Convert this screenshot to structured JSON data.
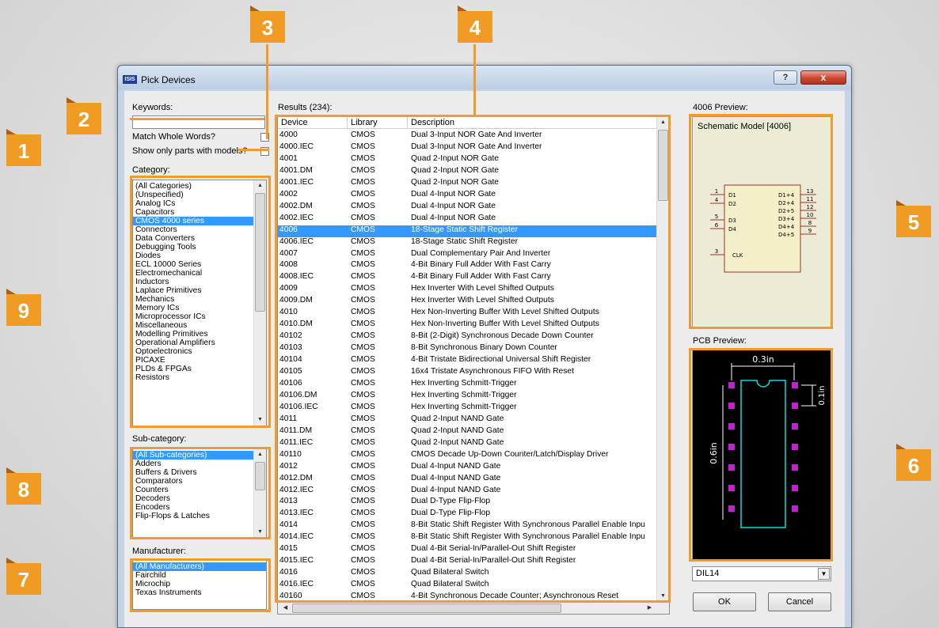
{
  "window": {
    "title": "Pick Devices",
    "app_badge": "ISIS",
    "help_label": "?",
    "close_label": "x"
  },
  "keywords": {
    "label": "Keywords:",
    "value": ""
  },
  "match_whole_words": {
    "label": "Match Whole Words?",
    "checked": false
  },
  "show_models": {
    "label": "Show only parts with models?",
    "checked": false
  },
  "category": {
    "label": "Category:",
    "items": [
      "(All Categories)",
      "(Unspecified)",
      "Analog ICs",
      "Capacitors",
      "CMOS 4000 series",
      "Connectors",
      "Data Converters",
      "Debugging Tools",
      "Diodes",
      "ECL 10000 Series",
      "Electromechanical",
      "Inductors",
      "Laplace Primitives",
      "Mechanics",
      "Memory ICs",
      "Microprocessor ICs",
      "Miscellaneous",
      "Modelling Primitives",
      "Operational Amplifiers",
      "Optoelectronics",
      "PICAXE",
      "PLDs & FPGAs",
      "Resistors"
    ],
    "selected": "CMOS 4000 series"
  },
  "subcategory": {
    "label": "Sub-category:",
    "items": [
      "(All Sub-categories)",
      "Adders",
      "Buffers & Drivers",
      "Comparators",
      "Counters",
      "Decoders",
      "Encoders",
      "Flip-Flops & Latches"
    ],
    "selected": "(All Sub-categories)"
  },
  "manufacturer": {
    "label": "Manufacturer:",
    "items": [
      "(All Manufacturers)",
      "Fairchild",
      "Microchip",
      "Texas Instruments"
    ],
    "selected": "(All Manufacturers)"
  },
  "results": {
    "label": "Results (234):",
    "columns": [
      "Device",
      "Library",
      "Description"
    ],
    "selected": "4006",
    "rows": [
      [
        "4000",
        "CMOS",
        "Dual 3-Input NOR Gate And Inverter"
      ],
      [
        "4000.IEC",
        "CMOS",
        "Dual 3-Input NOR Gate And Inverter"
      ],
      [
        "4001",
        "CMOS",
        "Quad 2-Input NOR Gate"
      ],
      [
        "4001.DM",
        "CMOS",
        "Quad 2-Input NOR Gate"
      ],
      [
        "4001.IEC",
        "CMOS",
        "Quad 2-Input NOR Gate"
      ],
      [
        "4002",
        "CMOS",
        "Dual 4-Input NOR Gate"
      ],
      [
        "4002.DM",
        "CMOS",
        "Dual 4-Input NOR Gate"
      ],
      [
        "4002.IEC",
        "CMOS",
        "Dual 4-Input NOR Gate"
      ],
      [
        "4006",
        "CMOS",
        "18-Stage Static Shift Register"
      ],
      [
        "4006.IEC",
        "CMOS",
        "18-Stage Static Shift Register"
      ],
      [
        "4007",
        "CMOS",
        "Dual Complementary Pair And Inverter"
      ],
      [
        "4008",
        "CMOS",
        "4-Bit Binary Full Adder With Fast Carry"
      ],
      [
        "4008.IEC",
        "CMOS",
        "4-Bit Binary Full Adder With Fast Carry"
      ],
      [
        "4009",
        "CMOS",
        "Hex Inverter With Level Shifted Outputs"
      ],
      [
        "4009.DM",
        "CMOS",
        "Hex Inverter With Level Shifted Outputs"
      ],
      [
        "4010",
        "CMOS",
        "Hex Non-Inverting Buffer With Level Shifted Outputs"
      ],
      [
        "4010.DM",
        "CMOS",
        "Hex Non-Inverting Buffer With Level Shifted Outputs"
      ],
      [
        "40102",
        "CMOS",
        "8-Bit (2-Digit) Synchronous Decade Down Counter"
      ],
      [
        "40103",
        "CMOS",
        "8-Bit Synchronous Binary Down Counter"
      ],
      [
        "40104",
        "CMOS",
        "4-Bit Tristate Bidirectional Universal Shift Register"
      ],
      [
        "40105",
        "CMOS",
        "16x4 Tristate Asynchronous FIFO With Reset"
      ],
      [
        "40106",
        "CMOS",
        "Hex Inverting Schmitt-Trigger"
      ],
      [
        "40106.DM",
        "CMOS",
        "Hex Inverting Schmitt-Trigger"
      ],
      [
        "40106.IEC",
        "CMOS",
        "Hex Inverting Schmitt-Trigger"
      ],
      [
        "4011",
        "CMOS",
        "Quad 2-Input NAND Gate"
      ],
      [
        "4011.DM",
        "CMOS",
        "Quad 2-Input NAND Gate"
      ],
      [
        "4011.IEC",
        "CMOS",
        "Quad 2-Input NAND Gate"
      ],
      [
        "40110",
        "CMOS",
        "CMOS Decade Up-Down Counter/Latch/Display Driver"
      ],
      [
        "4012",
        "CMOS",
        "Dual 4-Input NAND Gate"
      ],
      [
        "4012.DM",
        "CMOS",
        "Dual 4-Input NAND Gate"
      ],
      [
        "4012.IEC",
        "CMOS",
        "Dual 4-Input NAND Gate"
      ],
      [
        "4013",
        "CMOS",
        "Dual D-Type Flip-Flop"
      ],
      [
        "4013.IEC",
        "CMOS",
        "Dual D-Type Flip-Flop"
      ],
      [
        "4014",
        "CMOS",
        "8-Bit Static Shift Register With Synchronous Parallel Enable Inpu"
      ],
      [
        "4014.IEC",
        "CMOS",
        "8-Bit Static Shift Register With Synchronous Parallel Enable Inpu"
      ],
      [
        "4015",
        "CMOS",
        "Dual 4-Bit Serial-In/Parallel-Out Shift Register"
      ],
      [
        "4015.IEC",
        "CMOS",
        "Dual 4-Bit Serial-In/Parallel-Out Shift Register"
      ],
      [
        "4016",
        "CMOS",
        "Quad Bilateral Switch"
      ],
      [
        "4016.IEC",
        "CMOS",
        "Quad Bilateral Switch"
      ],
      [
        "40160",
        "CMOS",
        "4-Bit Synchronous Decade Counter; Asynchronous Reset"
      ]
    ]
  },
  "schematic_preview": {
    "label": "4006 Preview:",
    "title": "Schematic Model [4006]",
    "left_pins": [
      {
        "num": "1",
        "name": "D1"
      },
      {
        "num": "4",
        "name": "D2"
      },
      {
        "num": "5",
        "name": "D3"
      },
      {
        "num": "6",
        "name": "D4"
      },
      {
        "num": "3",
        "name": "CLK"
      }
    ],
    "right_pins": [
      {
        "num": "13",
        "name": "D1+4"
      },
      {
        "num": "11",
        "name": "D2+4"
      },
      {
        "num": "12",
        "name": "D2+5"
      },
      {
        "num": "10",
        "name": "D3+4"
      },
      {
        "num": "8",
        "name": "D4+4"
      },
      {
        "num": "9",
        "name": "D4+5"
      }
    ]
  },
  "pcb_preview": {
    "label": "PCB Preview:",
    "width_dim": "0.3in",
    "pitch_dim": "0.1in",
    "length_dim": "0.6in",
    "package": "DIL14"
  },
  "buttons": {
    "ok": "OK",
    "cancel": "Cancel"
  },
  "callouts": [
    "1",
    "2",
    "3",
    "4",
    "5",
    "6",
    "7",
    "8",
    "9"
  ],
  "colors": {
    "accent": "#ef9b24",
    "selection": "#3399ff",
    "pcb_bg": "#000000",
    "pcb_pad": "#c020d0",
    "pcb_outline": "#00e0e0"
  }
}
